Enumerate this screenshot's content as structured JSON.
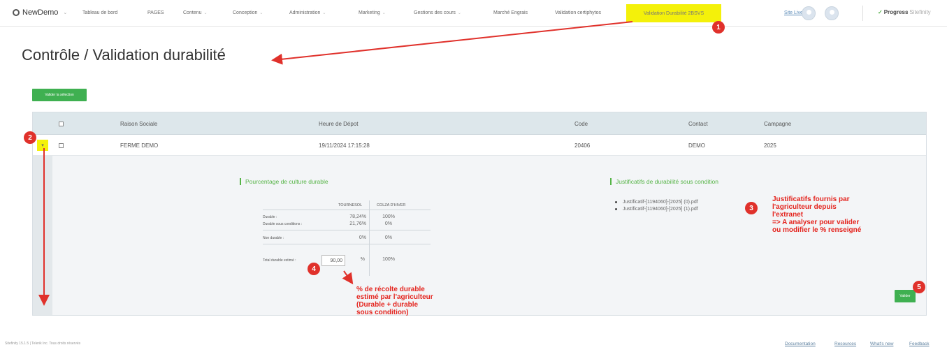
{
  "nav": {
    "brand": "NewDemo",
    "items": [
      {
        "label": "Tableau de bord",
        "caret": false
      },
      {
        "label": "PAGES",
        "caret": false
      },
      {
        "label": "Contenu",
        "caret": true
      },
      {
        "label": "Conception",
        "caret": true
      },
      {
        "label": "Administration",
        "caret": true
      },
      {
        "label": "Marketing",
        "caret": true
      },
      {
        "label": "Gestions des cours",
        "caret": true
      },
      {
        "label": "Marché Engrais",
        "caret": false
      },
      {
        "label": "Validation certiphytos",
        "caret": false
      }
    ],
    "active_item": "Validation Durabilité 2BSVS",
    "site_live": "Site Live",
    "progress_brand": "Progress",
    "progress_product": "Sitefinity"
  },
  "page": {
    "title": "Contrôle / Validation durabilité",
    "validate_selection_label": "Valider la sélection"
  },
  "grid": {
    "columns": [
      "Raison Sociale",
      "Heure de Dépot",
      "Code",
      "Contact",
      "Campagne"
    ],
    "rows": [
      {
        "raison_sociale": "FERME DEMO",
        "heure_depot": "19/11/2024 17:15:28",
        "code": "20406",
        "contact": "DEMO",
        "campagne": "2025",
        "expander_icon": "▾"
      }
    ]
  },
  "detail": {
    "pct_section_title": "Pourcentage de culture durable",
    "crops": [
      "TOURNESOL",
      "COLZA D'HIVER"
    ],
    "rows": [
      {
        "label": "Durable :",
        "values": [
          "78,24%",
          "100%"
        ]
      },
      {
        "label": "Durable sous conditions :",
        "values": [
          "21,76%",
          "0%"
        ]
      },
      {
        "label": "Non durable :",
        "values": [
          "0%",
          "0%"
        ]
      }
    ],
    "total_label": "Total durable estimé :",
    "total_input_value": "90,00",
    "total_unit": "%",
    "total_colza": "100%",
    "justif_section_title": "Justificatifs de durabilité sous condition",
    "justif_files": [
      "Justificatif-[1194060]-[2025] (0).pdf",
      "Justificatif-[1194060]-[2025] (1).pdf"
    ],
    "save_label": "Valider"
  },
  "annotations": {
    "markers": [
      "1",
      "2",
      "3",
      "4",
      "5"
    ],
    "note_justif": [
      "Justificatifs fournis par",
      "l'agriculteur depuis",
      "l'extranet",
      "=> A analyser pour valider",
      "ou modifier le % renseigné"
    ],
    "note_estimate": [
      "% de récolte durable",
      "estimé par l'agriculteur",
      "(Durable + durable",
      "sous condition)"
    ],
    "arrow_color": "#e0312b"
  },
  "footer": {
    "left": "Sitefinity 15.1.5 | Telerik Inc. Tous droits réservés",
    "links": [
      "Documentation",
      "Resources",
      "What's new",
      "Feedback"
    ]
  },
  "colors": {
    "highlight": "#f4f10a",
    "green": "#3fb051",
    "annotation_red": "#e4251f"
  }
}
